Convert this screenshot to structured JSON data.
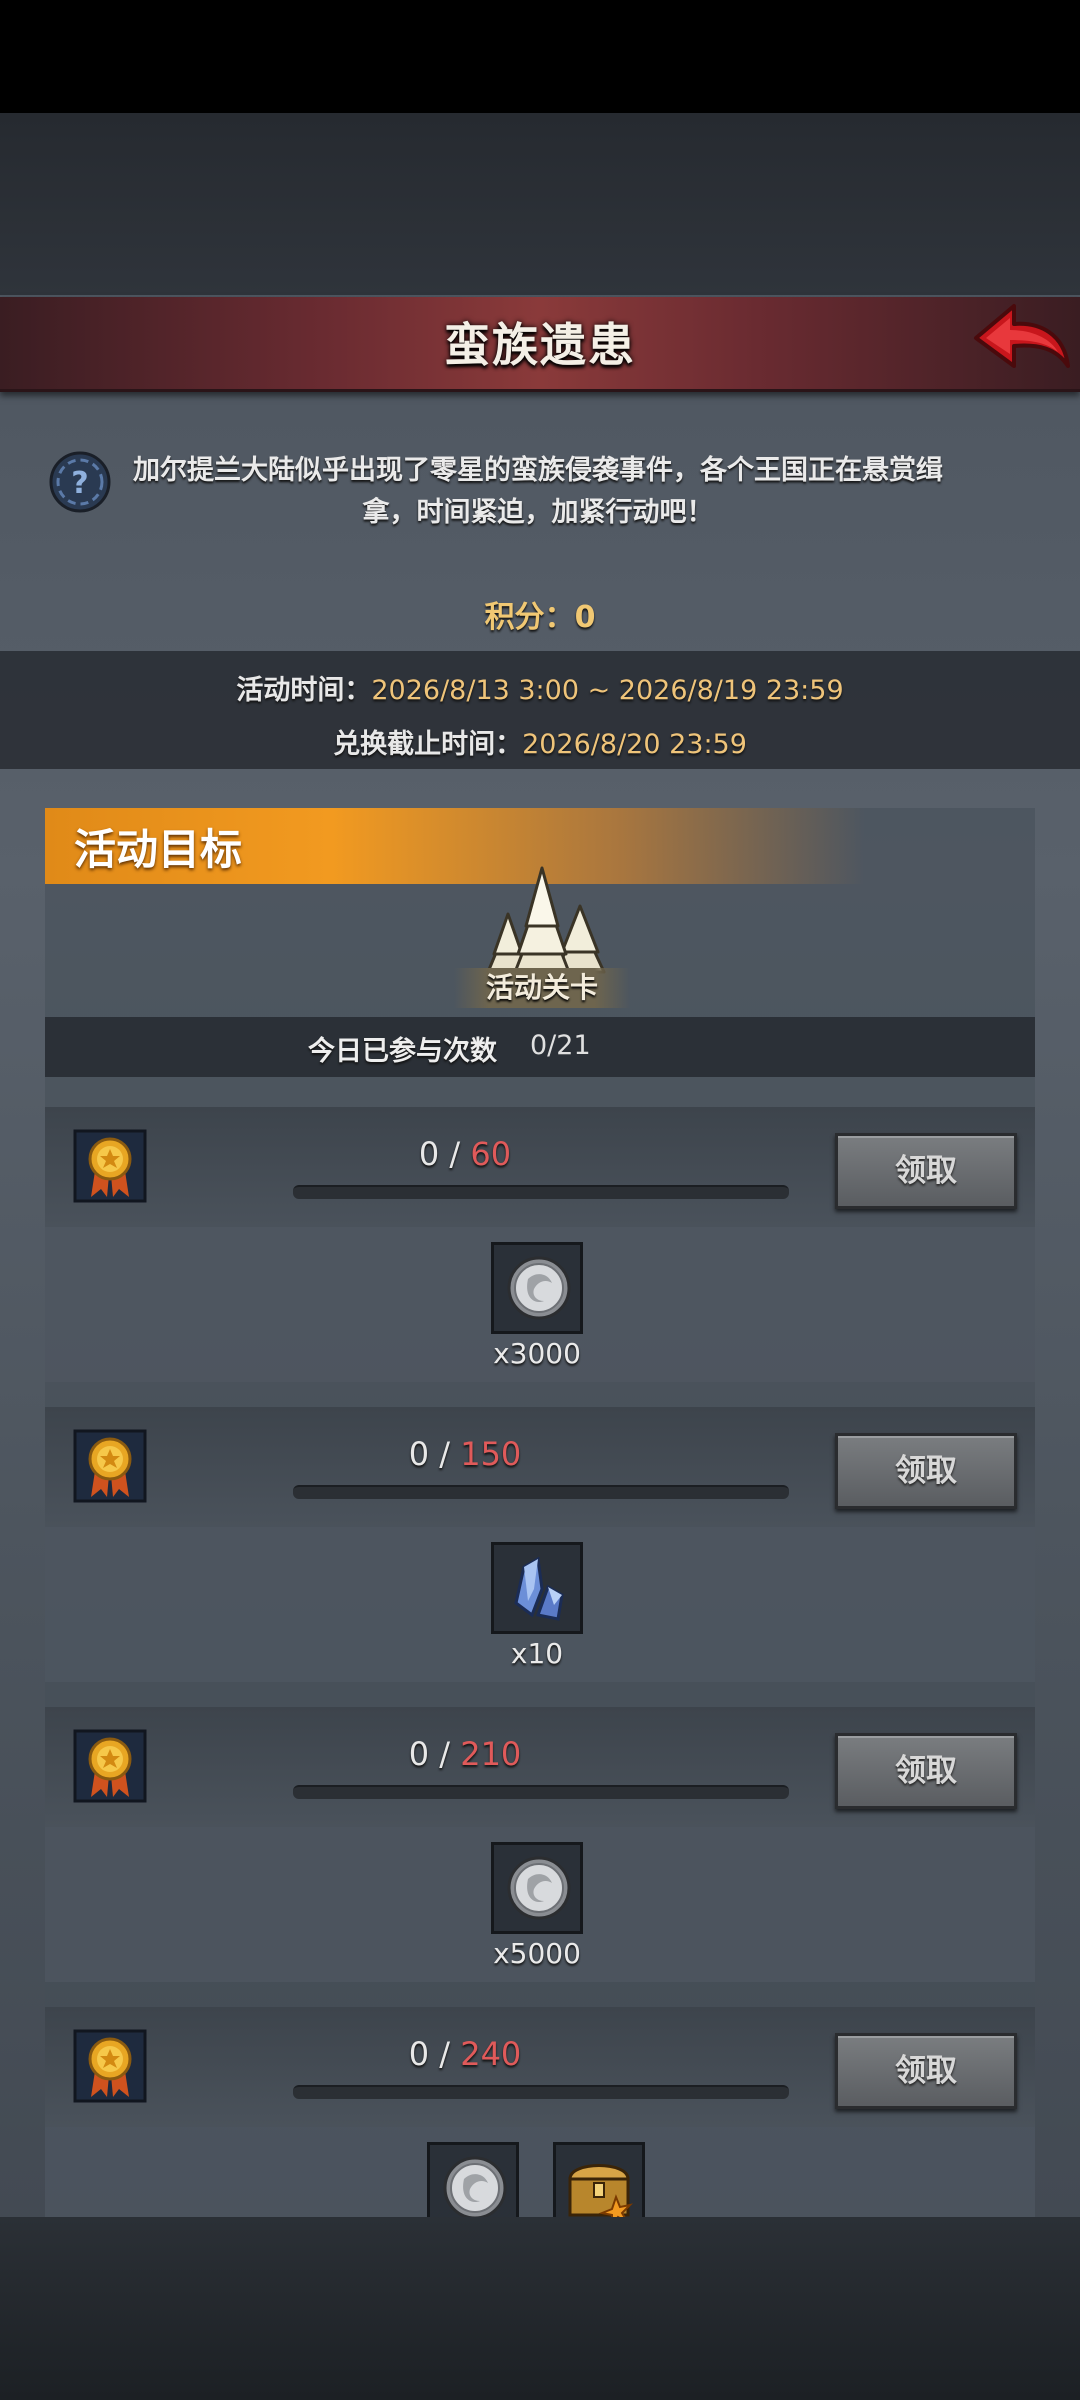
{
  "header": {
    "title": "蛮族遗患"
  },
  "description": "加尔提兰大陆似乎出现了零星的蛮族侵袭事件，各个王国正在悬赏缉拿，时间紧迫，加紧行动吧！",
  "score": {
    "label": "积分：",
    "value": "0"
  },
  "activity_time": {
    "label": "活动时间：",
    "value": "2026/8/13 3:00 ~ 2026/8/19 23:59"
  },
  "exchange_deadline": {
    "label": "兑换截止时间：",
    "value": "2026/8/20 23:59"
  },
  "goal": {
    "title": "活动目标",
    "stage_label": "活动关卡",
    "attempts_label": "今日已参与次数",
    "attempts_value": "0/21"
  },
  "rewards": [
    {
      "current": "0",
      "sep": " / ",
      "target": "60",
      "claim_label": "领取",
      "progress": 0,
      "items": [
        {
          "icon": "silver-coin-icon",
          "qty": "x3000"
        }
      ]
    },
    {
      "current": "0",
      "sep": " / ",
      "target": "150",
      "claim_label": "领取",
      "progress": 0,
      "items": [
        {
          "icon": "crystal-icon",
          "qty": "x10"
        }
      ]
    },
    {
      "current": "0",
      "sep": " / ",
      "target": "210",
      "claim_label": "领取",
      "progress": 0,
      "items": [
        {
          "icon": "silver-coin-icon",
          "qty": "x5000"
        }
      ]
    },
    {
      "current": "0",
      "sep": " / ",
      "target": "240",
      "claim_label": "领取",
      "progress": 0,
      "items": [
        {
          "icon": "silver-coin-icon",
          "qty": ""
        },
        {
          "icon": "treasure-chest-icon",
          "qty": ""
        }
      ]
    }
  ],
  "colors": {
    "accent": "#f29a20",
    "score": "#f1c873",
    "target": "#e05a5a",
    "header": "#8a3a3a"
  }
}
